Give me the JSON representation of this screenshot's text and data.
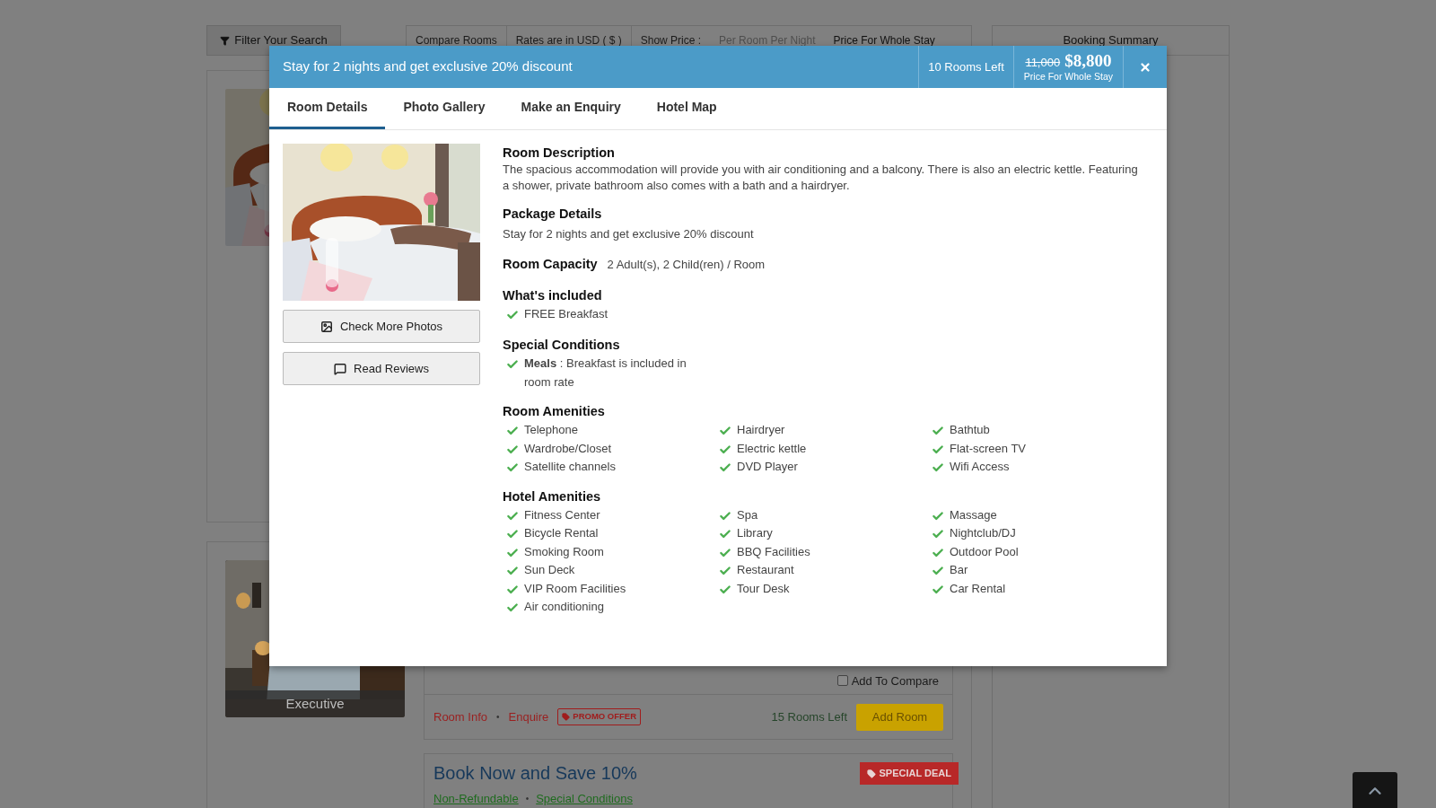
{
  "page": {
    "filter_button": "Filter Your Search",
    "compare_bar": {
      "compare": "Compare Rooms",
      "rates": "Rates are in USD ( $ )",
      "show_price_label": "Show Price :",
      "price_options": [
        {
          "label": "Per Room Per Night",
          "selected": false
        },
        {
          "label": "Price For Whole Stay",
          "selected": true
        }
      ]
    },
    "booking_summary": "Booking Summary",
    "room_card": {
      "image_caption": "Executive",
      "add_to_compare": {
        "label": "Add To Compare",
        "checked": false
      },
      "links": [
        {
          "label": "Room Info"
        },
        {
          "label": "•"
        },
        {
          "label": "Enquire"
        }
      ],
      "badge": "PROMO OFFER",
      "rooms_left": "15 Rooms Left",
      "add_button": "Add Room"
    },
    "offer": {
      "title": "Book Now and Save 10%",
      "badge": "SPECIAL DEAL",
      "links": [
        {
          "label": "Non-Refundable"
        },
        {
          "label": "•"
        },
        {
          "label": "Special Conditions"
        }
      ]
    }
  },
  "modal": {
    "title": "Stay for 2 nights and get exclusive 20% discount",
    "rooms_left": "10 Rooms Left",
    "old_price": "11,000",
    "price": "$8,800",
    "price_note": "Price For Whole Stay",
    "tabs": [
      {
        "label": "Room Details",
        "selected": true
      },
      {
        "label": "Photo Gallery",
        "selected": false
      },
      {
        "label": "Make an Enquiry",
        "selected": false
      },
      {
        "label": "Hotel Map",
        "selected": false
      }
    ],
    "buttons": [
      {
        "kind": "photos",
        "label": "Check More Photos"
      },
      {
        "kind": "reviews",
        "label": "Read Reviews"
      }
    ],
    "sections": [
      {
        "kind": "text",
        "heading": "Room Description",
        "text": "The spacious accommodation will provide you with air conditioning and a balcony. There is also an electric kettle. Featuring a shower, private bathroom also comes with a bath and a hairdryer."
      },
      {
        "kind": "text",
        "heading": "Package Details",
        "text": "Stay for 2 nights and get exclusive 20% discount"
      },
      {
        "kind": "inline",
        "heading": "Room Capacity",
        "text": "2 Adult(s), 2 Child(ren) / Room"
      },
      {
        "kind": "list",
        "heading": "What's included",
        "items": [
          "FREE Breakfast"
        ]
      },
      {
        "kind": "list",
        "heading": "Special Conditions",
        "items": [
          "**Meals** : Breakfast is included in room rate"
        ]
      },
      {
        "kind": "grid",
        "heading": "Room Amenities",
        "columns": [
          [
            "Telephone",
            "Wardrobe/Closet",
            "Satellite channels"
          ],
          [
            "Hairdryer",
            "Electric kettle",
            "DVD Player"
          ],
          [
            "Bathtub",
            "Flat-screen TV",
            "Wifi Access"
          ]
        ]
      },
      {
        "kind": "grid",
        "heading": "Hotel Amenities",
        "columns": [
          [
            "Fitness Center",
            "Bicycle Rental",
            "Smoking Room",
            "Sun Deck",
            "VIP Room Facilities",
            "Air conditioning"
          ],
          [
            "Spa",
            "Library",
            "BBQ Facilities",
            "Restaurant",
            "Tour Desk"
          ],
          [
            "Massage",
            "Nightclub/DJ",
            "Outdoor Pool",
            "Bar",
            "Car Rental"
          ]
        ]
      }
    ]
  }
}
